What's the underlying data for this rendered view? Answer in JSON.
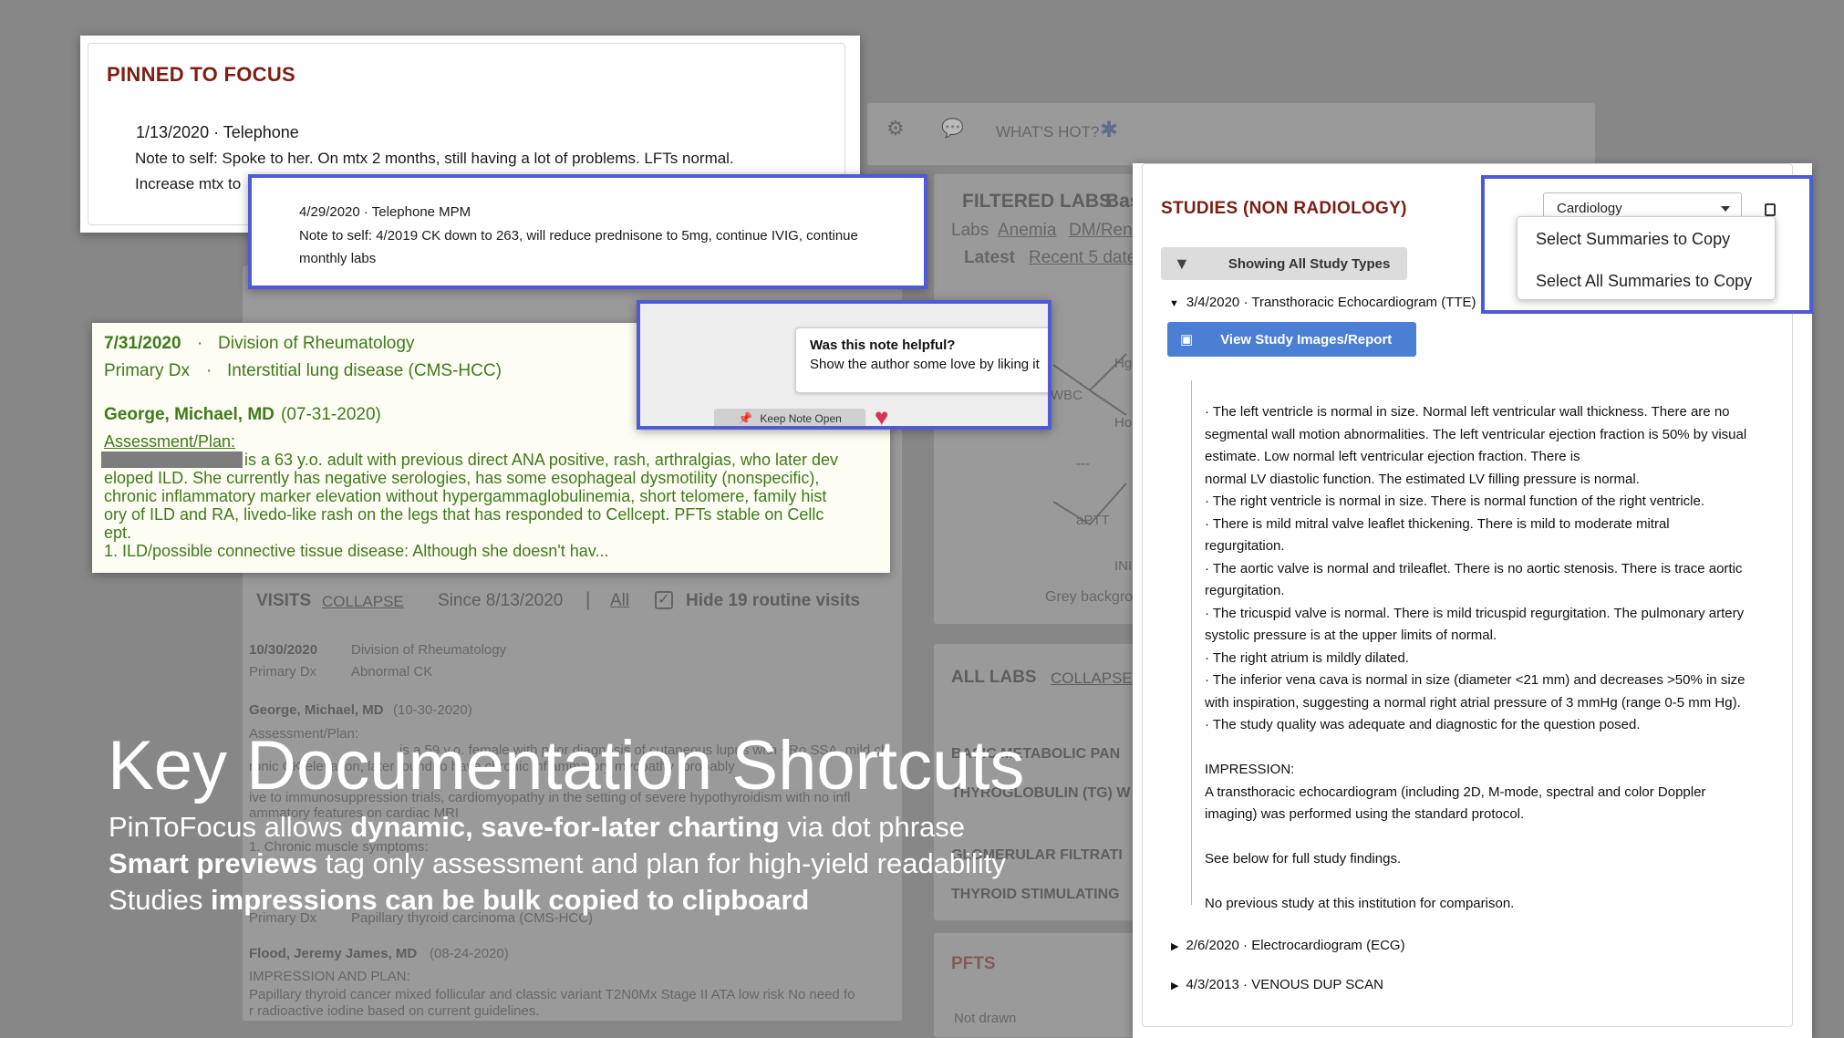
{
  "pinned": {
    "title": "PINNED TO FOCUS",
    "note1_header": "1/13/2020 · Telephone",
    "note1_line1": "Note to self: Spoke to her. On mtx 2 months, still having a lot of problems. LFTs normal.",
    "note1_line2": "Increase mtx to",
    "note2_header": "4/29/2020 · Telephone MPM",
    "note2_line1": "Note to self: 4/2019 CK down to 263, will reduce prednisone to 5mg, continue IVIG, continue",
    "note2_line2": "monthly labs"
  },
  "toolbar": {
    "whats_hot": "WHAT'S HOT?"
  },
  "filtered_labs": {
    "title": "FILTERED LABS",
    "title_tail": "Bas",
    "labs_label": "Labs",
    "anemia": "Anemia",
    "dm": "DM/Ren",
    "latest": "Latest",
    "recent": "Recent 5 date"
  },
  "graph_labels": {
    "wbc": "WBC",
    "aptt": "aPTT",
    "hg": "Hg",
    "ho": "Ho",
    "ini": "INI",
    "dash": "---",
    "grey": "Grey backgro"
  },
  "preview": {
    "date": "7/31/2020",
    "division": "Division of Rheumatology",
    "primary_dx_label": "Primary Dx",
    "primary_dx": "Interstitial lung disease (CMS-HCC)",
    "author": "George, Michael, MD",
    "author_date": "(07-31-2020)",
    "ap_label": "Assessment/Plan:",
    "line1": "is a 63 y.o. adult with previous direct ANA positive, rash, arthralgias, who later dev",
    "line2": "eloped ILD. She currently has negative serologies, has some esophageal dysmotility (nonspecific),",
    "line3": "chronic inflammatory marker elevation without hypergammaglobulinemia, short telomere, family hist",
    "line4": "ory of ILD and RA, livedo-like rash on the legs that has responded to Cellcept. PFTs stable on Cellc",
    "line5": "ept.",
    "line6": "1. ILD/possible connective tissue disease: Although she doesn't hav..."
  },
  "helpful": {
    "title": "Was this note helpful?",
    "text": "Show the author some love by liking it",
    "keep_open": "Keep Note Open"
  },
  "visits": {
    "title": "VISITS",
    "collapse": "COLLAPSE",
    "since": "Since 8/13/2020",
    "all": "All",
    "hide": "Hide 19 routine visits",
    "v1_date": "10/30/2020",
    "v1_div": "Division of Rheumatology",
    "v1_dx_label": "Primary Dx",
    "v1_dx": "Abnormal CK",
    "v1_author": "George, Michael, MD",
    "v1_author_date": "(10-30-2020)",
    "v1_ap": "Assessment/Plan:",
    "v1_l1": "is a 59 y.o. female with prior diagnosis of cutaneous lupus with +Ro SSA, mild ch",
    "v1_l2": "ronic CK elevation, later found to have chronic inflammatory myopathy (probably",
    "v1_l3": "ive to immunosuppression trials, cardiomyopathy in the setting of severe hypothyroidism with no infl",
    "v1_l4": "ammatory features on cardiac MRI",
    "v1_l5": "1. Chronic muscle symptoms:",
    "v2_dx_label": "Primary Dx",
    "v2_dx": "Papillary thyroid carcinoma (CMS-HCC)",
    "v2_author": "Flood, Jeremy James, MD",
    "v2_author_date": "(08-24-2020)",
    "v2_ip": "IMPRESSION AND PLAN:",
    "v2_l1": "Papillary thyroid cancer mixed follicular and classic variant T2N0Mx Stage II ATA low risk No need fo",
    "v2_l2": "r radioactive iodine based on current guidelines."
  },
  "all_labs": {
    "title": "ALL LABS",
    "collapse": "COLLAPSE",
    "item1": "BASIC METABOLIC PAN",
    "item2": "THYROGLOBULIN (TG) W",
    "item3": "GLOMERULAR FILTRATI",
    "item4": "THYROID STIMULATING"
  },
  "pfts": {
    "title": "PFTS",
    "not_drawn": "Not drawn"
  },
  "studies": {
    "title": "STUDIES (NON RADIOLOGY)",
    "filter_label": "Showing All Study Types",
    "dropdown_value": "Cardiology",
    "menu_item1": "Select Summaries to Copy",
    "menu_item2": "Select All Summaries to Copy",
    "study1_header": "3/4/2020 · Transthoracic Echocardiogram (TTE)",
    "view_button": "View Study Images/Report",
    "body_lines": [
      "· The left ventricle is normal in size. Normal left ventricular wall thickness. There are no",
      "segmental wall motion abnormalities. The left ventricular ejection fraction is 50% by visual",
      "estimate. Low normal left ventricular ejection fraction. There is",
      "normal LV diastolic function. The estimated LV filling pressure is normal.",
      "· The right ventricle is normal in size. There is normal function of the right ventricle.",
      "· There is mild mitral valve leaflet thickening. There is mild to moderate mitral",
      "regurgitation.",
      "· The aortic valve is normal and trileaflet. There is no aortic stenosis. There is trace aortic",
      "regurgitation.",
      "· The tricuspid valve is normal. There is mild tricuspid regurgitation. The pulmonary artery",
      "systolic pressure is at the upper limits of normal.",
      "· The right atrium is mildly dilated.",
      "· The inferior vena cava is normal in size (diameter <21 mm) and decreases >50% in size",
      "with inspiration, suggesting a normal right atrial pressure of 3 mmHg (range 0-5 mm Hg).",
      "· The study quality was adequate and diagnostic for the question posed.",
      "",
      "IMPRESSION:",
      "A transthoracic echocardiogram (including 2D, M-mode, spectral and color Doppler",
      "imaging) was performed using the standard protocol.",
      "",
      "See below for full study findings.",
      "",
      "No previous study at this institution for comparison."
    ],
    "study2": "2/6/2020 · Electrocardiogram (ECG)",
    "study3": "4/3/2013 · VENOUS DUP SCAN"
  },
  "slide": {
    "heading": "Key Documentation Shortcuts",
    "l1_a": "PinToFocus allows ",
    "l1_b": "dynamic, save-for-later charting",
    "l1_c": " via dot phrase",
    "l2_a": "Smart previews",
    "l2_b": " tag only assessment and plan for high-yield readability",
    "l3_a": "Studies ",
    "l3_b": "impressions can be bulk copied to clipboard"
  },
  "colors": {
    "highlight_blue": "#4f5bd5",
    "title_red": "#7c1e14",
    "preview_green": "#3f7a1c",
    "heart": "#d6355b",
    "button_blue": "#4a7fd3"
  },
  "icons": [
    "gear-icon",
    "chat-icon",
    "bug-icon",
    "filter-icon",
    "image-icon",
    "clipboard-icon",
    "pin-icon",
    "heart-icon",
    "caret-down-icon",
    "checkbox-icon"
  ]
}
